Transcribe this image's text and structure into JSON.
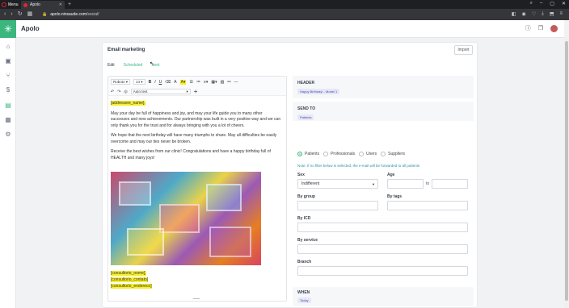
{
  "browser": {
    "menu_label": "Menu",
    "tab_title": "Apolo",
    "url_host": "apolo.ninsaude.com",
    "url_path": "/social/"
  },
  "app": {
    "name": "Apolo"
  },
  "page": {
    "title": "Email marketing",
    "import_label": "Import",
    "tabs": [
      "Edit",
      "Scheduled",
      "Sent"
    ]
  },
  "toolbar": {
    "font_family": "Roboto",
    "font_size": "14",
    "text_style": "Auto text"
  },
  "editor": {
    "addressee_tag": "[addressee_name],",
    "paragraph_1": "May your day be full of happiness and joy, and may your life guide you to many other successes and new achievements. Our partnership was built in a very positive way and we can only thank you for the trust and for always bringing with you a lot of cheers.",
    "paragraph_2": "We hope that the next birthday will have many triumphs to share. May all difficulties be easily overcome and may our ties never be broken.",
    "paragraph_3": "Receive the best wishes from our clinic! Congratulations and have a happy birthday full of HEALTH and many joys!",
    "signature_1": "[consultorio_nome],",
    "signature_2": "[consultorio_contato]",
    "signature_3": "[consultorio_endereco]"
  },
  "settings": {
    "header_label": "HEADER",
    "header_value": "Happy Birthday! - Model 1",
    "send_to_label": "SEND TO",
    "send_to_value": "Patients",
    "radio_options": [
      "Patients",
      "Professionals",
      "Users",
      "Suppliers"
    ],
    "selected_option": "Patients",
    "note": "Note: If no filter below is selected, the e-mail will be forwarded to all patients",
    "sex_label": "Sex",
    "sex_value": "Indifferent",
    "age_label": "Age",
    "age_to": "to",
    "group_label": "By group",
    "tags_label": "By tags",
    "icd_label": "By ICD",
    "service_label": "By service",
    "branch_label": "Branch",
    "when_label": "WHEN",
    "when_value": "Today"
  },
  "colors": {
    "brand": "#3bb77e",
    "highlight": "#f5ef2b",
    "chip_bg": "#e6e7f7"
  }
}
